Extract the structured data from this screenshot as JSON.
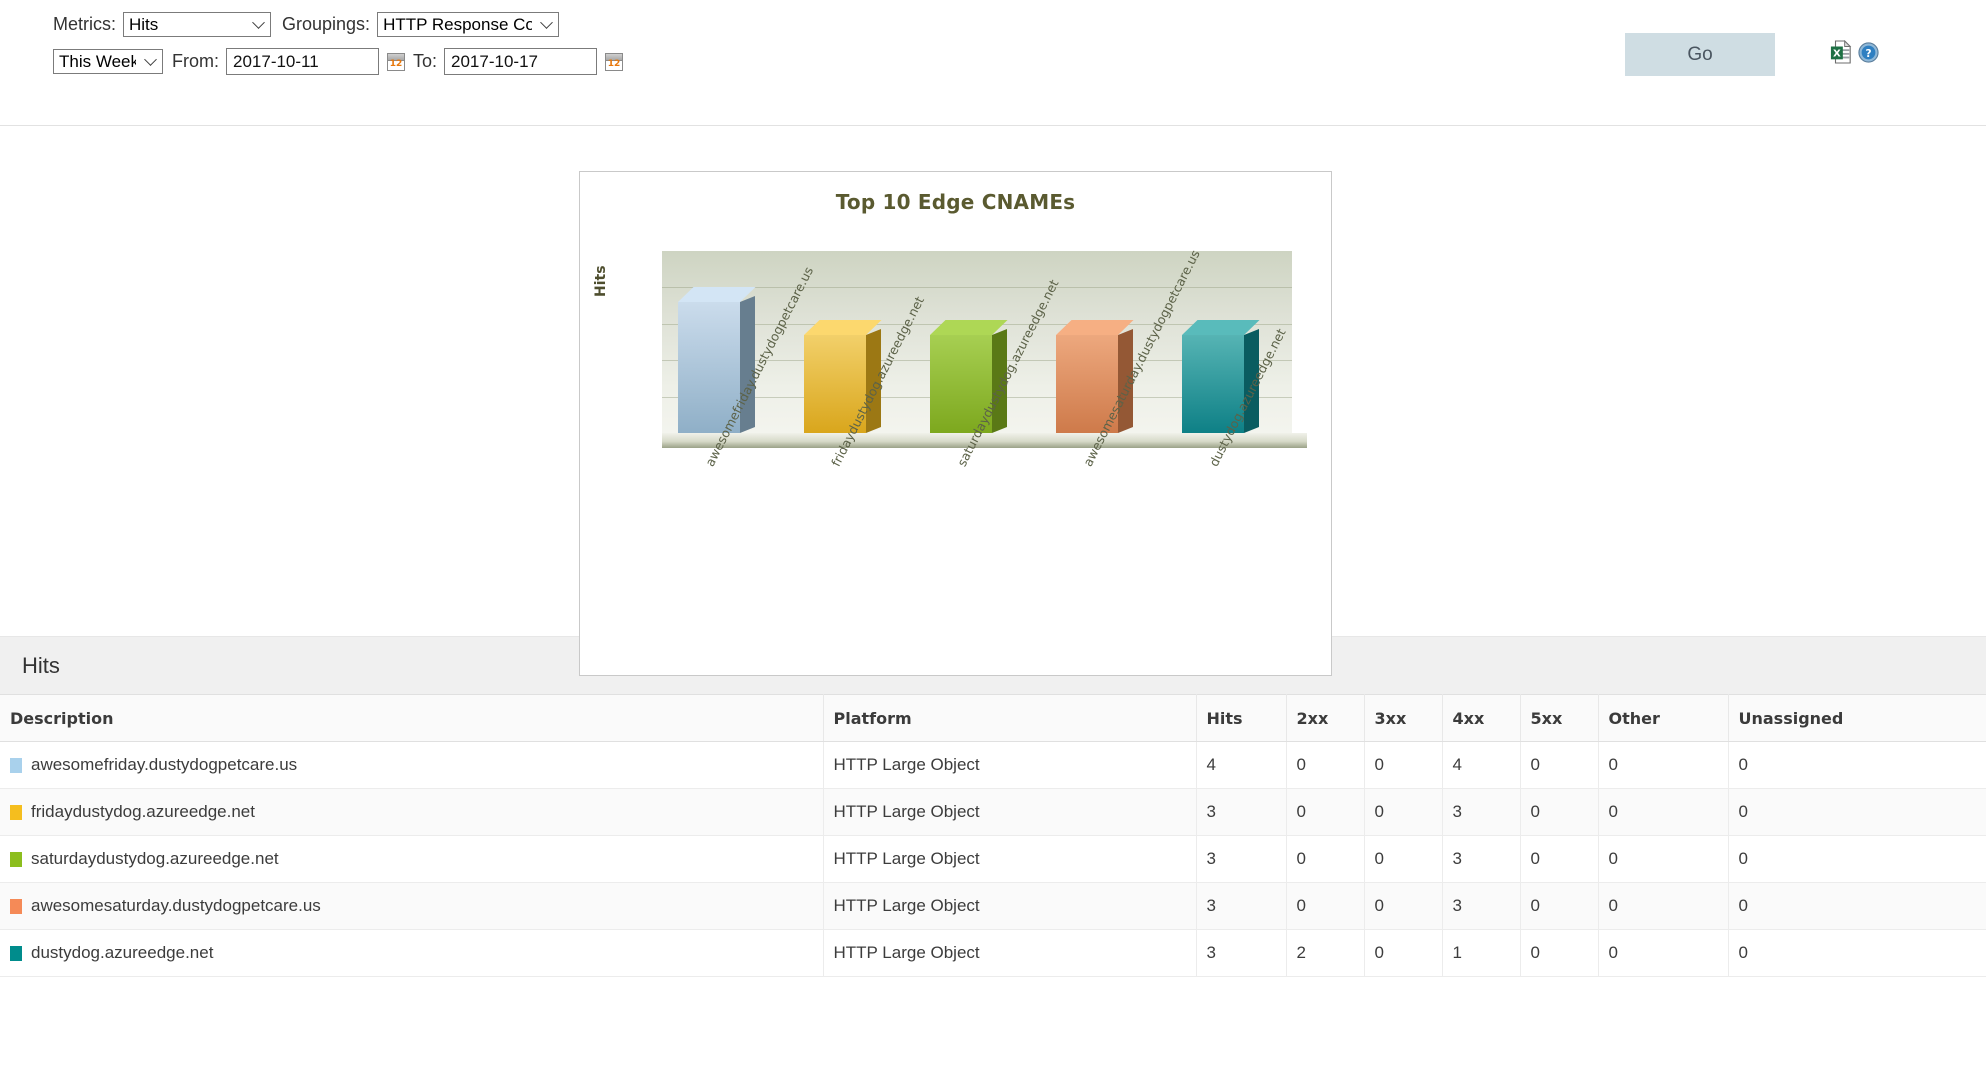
{
  "toolbar": {
    "metrics_label": "Metrics:",
    "metrics_value": "Hits",
    "groupings_label": "Groupings:",
    "groupings_value": "HTTP Response Codes",
    "range_value": "This Week",
    "from_label": "From:",
    "from_value": "2017-10-11",
    "to_label": "To:",
    "to_value": "2017-10-17",
    "go_label": "Go",
    "export_icon": "excel-export-icon",
    "help_icon": "help-icon",
    "calendar_icon": "calendar-icon",
    "chevron_icon": "chevron-down-icon"
  },
  "chart_data": {
    "type": "bar",
    "title": "Top 10 Edge CNAMEs",
    "xlabel": "",
    "ylabel": "Hits",
    "ylim": [
      0,
      5
    ],
    "grid": true,
    "legend": "none",
    "categories": [
      "awesomefriday.dustydogpetcare.us",
      "fridaydustydog.azureedge.net",
      "saturdaydustydog.azureedge.net",
      "awesomesaturday.dustydogpetcare.us",
      "dustydog.azureedge.net"
    ],
    "values": [
      4,
      3,
      3,
      3,
      3
    ],
    "colors": [
      "#8FAFC7",
      "#D9A61C",
      "#7DA81E",
      "#CE7A4A",
      "#0E8086"
    ],
    "colors_light": [
      "#CBDCEC",
      "#F2D06A",
      "#A7CF52",
      "#EDA87E",
      "#56B4B4"
    ]
  },
  "section": {
    "title": "Hits"
  },
  "table": {
    "columns": [
      "Description",
      "Platform",
      "Hits",
      "2xx",
      "3xx",
      "4xx",
      "5xx",
      "Other",
      "Unassigned"
    ],
    "rows": [
      {
        "swatch": "#A9D1EC",
        "description": "awesomefriday.dustydogpetcare.us",
        "platform": "HTTP Large Object",
        "hits": "4",
        "c2xx": "0",
        "c3xx": "0",
        "c4xx": "4",
        "c5xx": "0",
        "other": "0",
        "unassigned": "0"
      },
      {
        "swatch": "#F5BE1E",
        "description": "fridaydustydog.azureedge.net",
        "platform": "HTTP Large Object",
        "hits": "3",
        "c2xx": "0",
        "c3xx": "0",
        "c4xx": "3",
        "c5xx": "0",
        "other": "0",
        "unassigned": "0"
      },
      {
        "swatch": "#8CBE1E",
        "description": "saturdaydustydog.azureedge.net",
        "platform": "HTTP Large Object",
        "hits": "3",
        "c2xx": "0",
        "c3xx": "0",
        "c4xx": "3",
        "c5xx": "0",
        "other": "0",
        "unassigned": "0"
      },
      {
        "swatch": "#F58A57",
        "description": "awesomesaturday.dustydogpetcare.us",
        "platform": "HTTP Large Object",
        "hits": "3",
        "c2xx": "0",
        "c3xx": "0",
        "c4xx": "3",
        "c5xx": "0",
        "other": "0",
        "unassigned": "0"
      },
      {
        "swatch": "#008C8C",
        "description": "dustydog.azureedge.net",
        "platform": "HTTP Large Object",
        "hits": "3",
        "c2xx": "2",
        "c3xx": "0",
        "c4xx": "1",
        "c5xx": "0",
        "other": "0",
        "unassigned": "0"
      }
    ]
  }
}
